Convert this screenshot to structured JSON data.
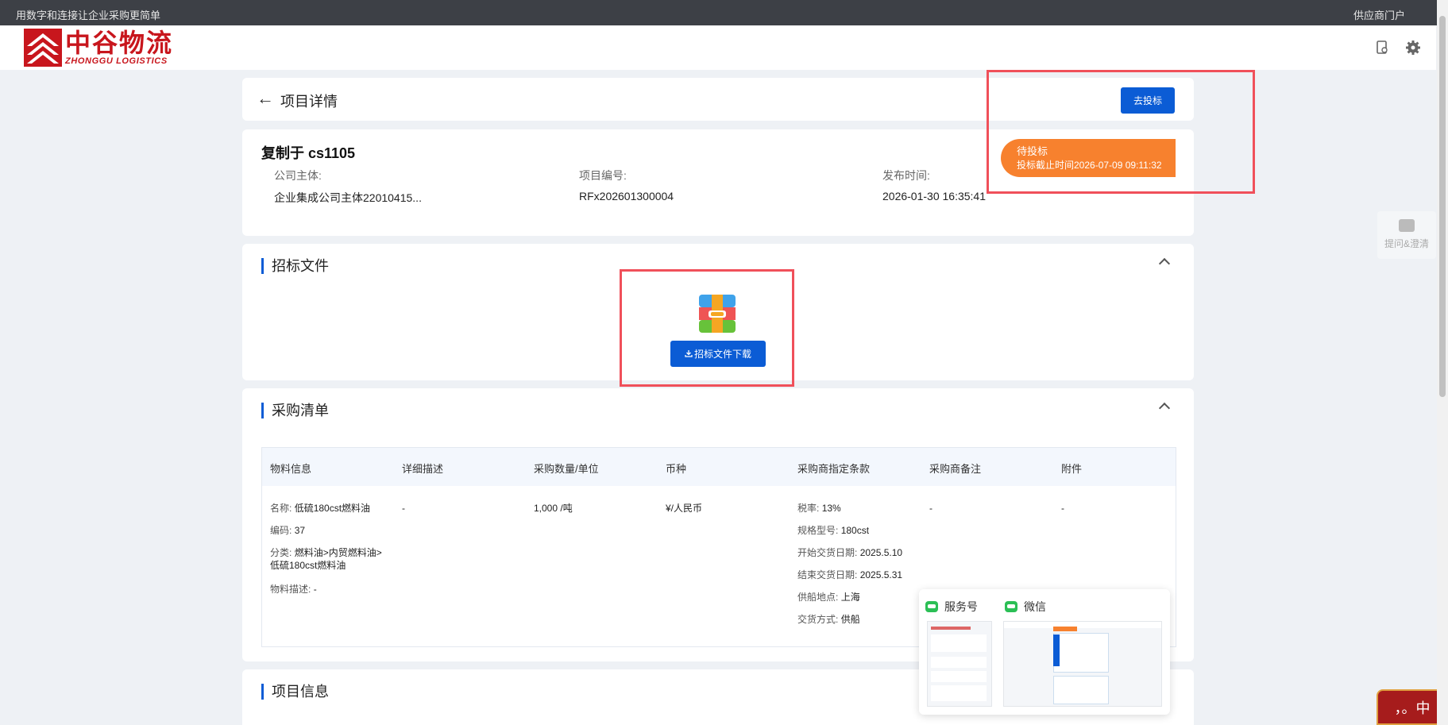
{
  "topbar": {
    "slogan": "用数字和连接让企业采购更简单",
    "portal": "供应商门户"
  },
  "logo": {
    "cn": "中谷物流",
    "en": "ZHONGGU LOGISTICS"
  },
  "page": {
    "back_icon": "←",
    "title": "项目详情",
    "bid_button": "去投标"
  },
  "project": {
    "title": "复制于 cs1105",
    "company_label": "公司主体:",
    "company_value": "企业集成公司主体22010415...",
    "code_label": "项目编号:",
    "code_value": "RFx202601300004",
    "publish_label": "发布时间:",
    "publish_value": "2026-01-30 16:35:41",
    "status": "待投标",
    "deadline": "投标截止时间2026-07-09 09:11:32"
  },
  "tender_docs": {
    "title": "招标文件",
    "download_button": "招标文件下载"
  },
  "purchase_list": {
    "title": "采购清单",
    "columns": [
      "物料信息",
      "详细描述",
      "采购数量/单位",
      "币种",
      "采购商指定条款",
      "采购商备注",
      "附件"
    ],
    "row": {
      "name_k": "名称:",
      "name_v": "低硫180cst燃料油",
      "code_k": "编码:",
      "code_v": "37",
      "cat_k": "分类:",
      "cat_v1": "燃料油>内贸燃料油>",
      "cat_v2": "低硫180cst燃料油",
      "desc_k": "物料描述:",
      "desc_v": "-",
      "detail": "-",
      "qty": "1,000 /吨",
      "currency": "¥/人民币",
      "terms": [
        {
          "k": "税率:",
          "v": "13%"
        },
        {
          "k": "规格型号:",
          "v": "180cst"
        },
        {
          "k": "开始交货日期:",
          "v": "2025.5.10"
        },
        {
          "k": "结束交货日期:",
          "v": "2025.5.31"
        },
        {
          "k": "供船地点:",
          "v": "上海"
        },
        {
          "k": "交货方式:",
          "v": "供船"
        }
      ],
      "remark": "-",
      "attachment": "-"
    }
  },
  "project_info": {
    "title": "项目信息"
  },
  "qr_popup": {
    "tab1": "服务号",
    "tab2": "微信"
  },
  "side_float": {
    "label": "提问&澄清"
  },
  "ime": {
    "text": "，。中"
  },
  "colors": {
    "primary": "#0b5cd5",
    "status": "#f7812e",
    "brand": "#c8161d",
    "highlight": "#f0505a"
  }
}
